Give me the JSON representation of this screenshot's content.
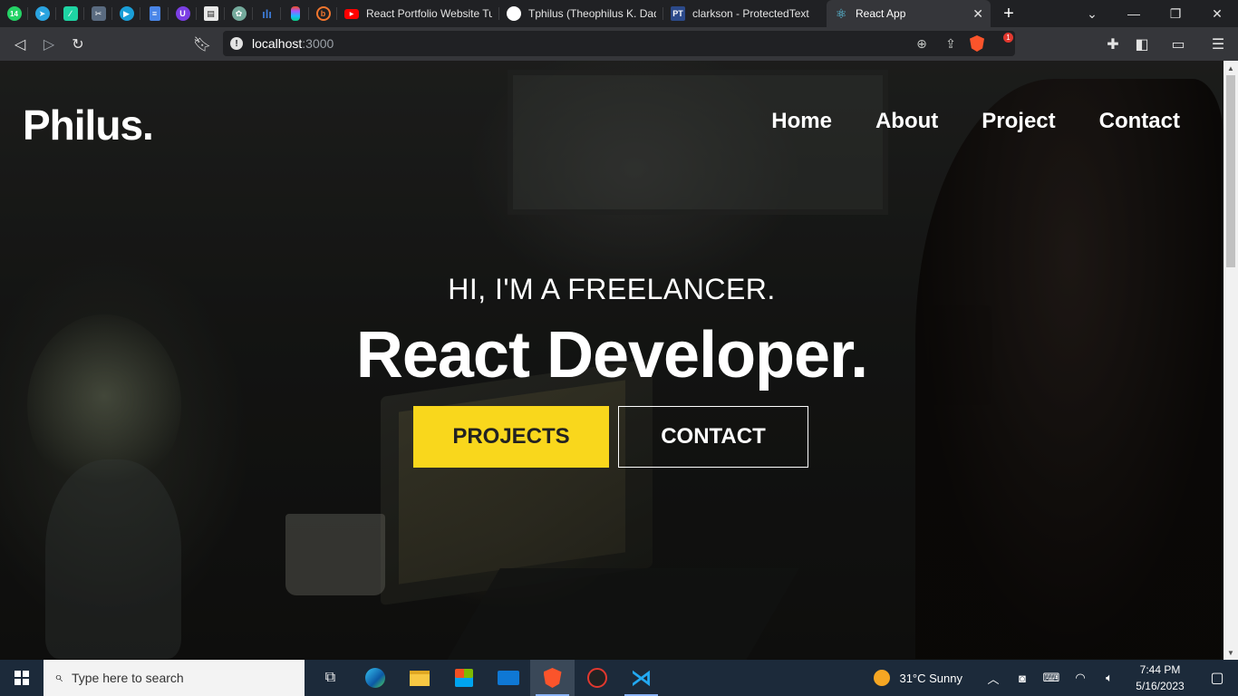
{
  "browser": {
    "pinned_tabs": [
      {
        "name": "whatsapp-icon",
        "badge": "14",
        "color": "#25d366"
      },
      {
        "name": "telegram-icon",
        "color": "#2aa3e0"
      },
      {
        "name": "feather-app-icon",
        "color": "#1ed4a3"
      },
      {
        "name": "scissors-app-icon",
        "color": "#5a6b80"
      },
      {
        "name": "play-app-icon",
        "color": "#1a9fd8"
      },
      {
        "name": "docs-icon",
        "color": "#4a86e8"
      },
      {
        "name": "u-app-icon",
        "color": "#7b3fe4"
      },
      {
        "name": "page-app-icon",
        "color": "#e8e8e8"
      },
      {
        "name": "chatgpt-icon",
        "color": "#74aa9c"
      },
      {
        "name": "bar-chart-app-icon",
        "color": "#3d7bd6"
      },
      {
        "name": "figma-icon",
        "color": "#f24e1e"
      },
      {
        "name": "b-app-icon",
        "color": "#f2762e"
      }
    ],
    "tabs": [
      {
        "title": "React Portfolio Website Tut",
        "favicon": "youtube-icon",
        "favicon_color": "#ff0000",
        "active": false
      },
      {
        "title": "Tphilus (Theophilus K. Dadz",
        "favicon": "github-icon",
        "favicon_color": "#ffffff",
        "active": false
      },
      {
        "title": "clarkson - ProtectedText",
        "favicon": "pt-icon",
        "favicon_text": "PT",
        "favicon_color": "#2c4a8a",
        "active": false
      },
      {
        "title": "React App",
        "favicon": "react-icon",
        "favicon_color": "#61dafb",
        "active": true
      }
    ],
    "new_tab_label": "+",
    "url_host": "localhost",
    "url_port": ":3000",
    "rewards_badge": "1"
  },
  "site": {
    "logo": "Philus.",
    "nav": [
      "Home",
      "About",
      "Project",
      "Contact"
    ],
    "hero_subtitle": "HI, I'M A FREELANCER.",
    "hero_title": "React Developer.",
    "primary_button": "PROJECTS",
    "secondary_button": "CONTACT",
    "accent_color": "#f9d71c"
  },
  "taskbar": {
    "search_placeholder": "Type here to search",
    "apps": [
      "task-view-icon",
      "edge-icon",
      "file-explorer-icon",
      "store-icon",
      "mail-icon",
      "brave-icon",
      "brave-nightly-icon",
      "vscode-icon"
    ],
    "weather": "31°C  Sunny",
    "time": "7:44 PM",
    "date": "5/16/2023"
  }
}
